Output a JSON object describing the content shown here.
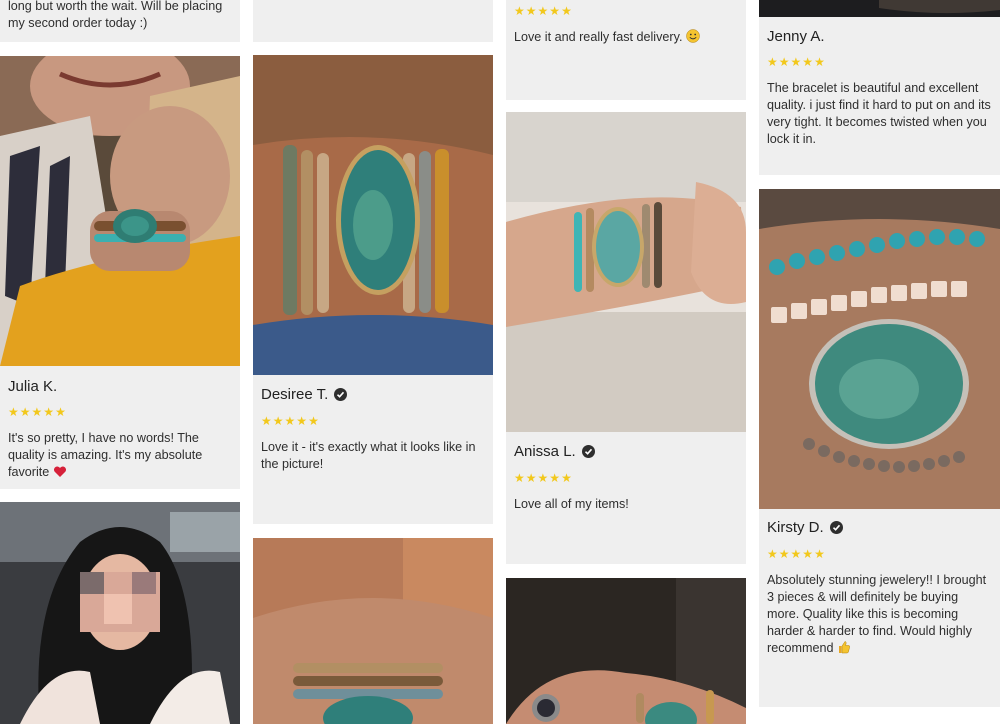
{
  "reviews": [
    {
      "id": "c1-top",
      "text": "long but worth the wait. Will be placing my second order today :)"
    },
    {
      "id": "julia",
      "name": "Julia K.",
      "rating": 5,
      "text": "It's so pretty, I have no words! The quality is amazing. It's my absolute favorite",
      "emoji": "heart-icon"
    },
    {
      "id": "desiree",
      "name": "Desiree T.",
      "rating": 5,
      "verified": true,
      "text": "Love it - it's exactly what it looks like in the picture!"
    },
    {
      "id": "c3-top",
      "rating": 5,
      "text": "Love it and really fast delivery.",
      "emoji": "smile-icon"
    },
    {
      "id": "anissa",
      "name": "Anissa L.",
      "rating": 5,
      "verified": true,
      "text": "Love all of my items!"
    },
    {
      "id": "jenny",
      "name": "Jenny A.",
      "rating": 5,
      "text": "The bracelet is beautiful and excellent quality. i just find it hard to put on and its very tight. It becomes twisted when you lock it in."
    },
    {
      "id": "kirsty",
      "name": "Kirsty D.",
      "rating": 5,
      "verified": true,
      "text": "Absolutely stunning jewelery!! I brought 3 pieces & will definitely be buying more. Quality like this is becoming harder & harder to find. Would highly recommend",
      "emoji": "thumbs-up-icon"
    }
  ],
  "icons": {
    "star": "★",
    "verified": "check-badge-icon"
  },
  "colors": {
    "star": "#f2c81c",
    "card_bg": "#efefef",
    "text": "#2e2e2e"
  }
}
